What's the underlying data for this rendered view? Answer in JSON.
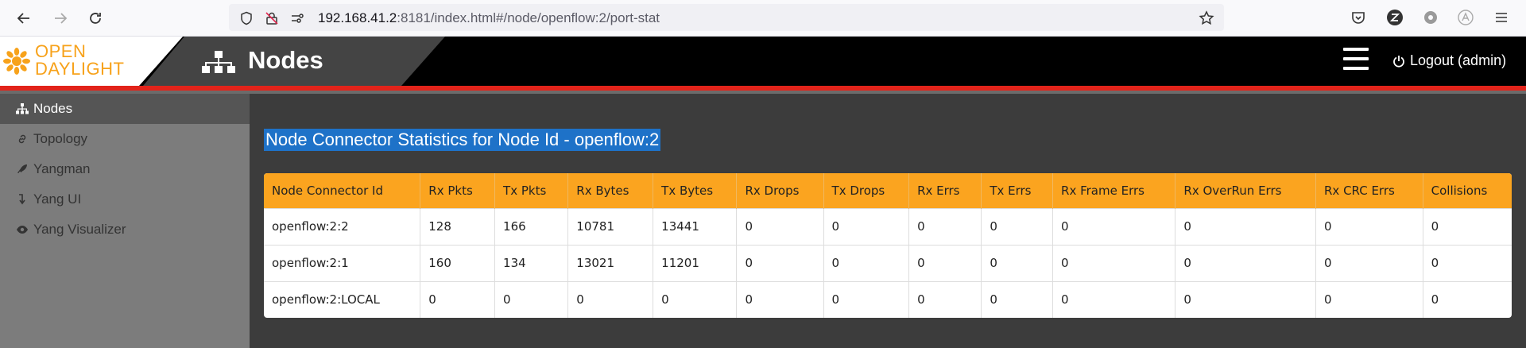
{
  "browser": {
    "url_host": "192.168.41.2",
    "url_path": ":8181/index.html#/node/openflow:2/port-stat"
  },
  "header": {
    "logo_line1": "OPEN",
    "logo_line2": "DAYLIGHT",
    "title": "Nodes",
    "logout_label": "Logout (admin)"
  },
  "sidebar": {
    "items": [
      {
        "label": "Nodes",
        "icon": "sitemap-icon"
      },
      {
        "label": "Topology",
        "icon": "link-icon"
      },
      {
        "label": "Yangman",
        "icon": "rocket-icon"
      },
      {
        "label": "Yang UI",
        "icon": "arrow-down-icon"
      },
      {
        "label": "Yang Visualizer",
        "icon": "eye-icon"
      }
    ]
  },
  "main": {
    "heading": "Node Connector Statistics for Node Id - openflow:2",
    "columns": [
      "Node Connector Id",
      "Rx Pkts",
      "Tx Pkts",
      "Rx Bytes",
      "Tx Bytes",
      "Rx Drops",
      "Tx Drops",
      "Rx Errs",
      "Tx Errs",
      "Rx Frame Errs",
      "Rx OverRun Errs",
      "Rx CRC Errs",
      "Collisions"
    ],
    "rows": [
      [
        "openflow:2:2",
        "128",
        "166",
        "10781",
        "13441",
        "0",
        "0",
        "0",
        "0",
        "0",
        "0",
        "0",
        "0"
      ],
      [
        "openflow:2:1",
        "160",
        "134",
        "13021",
        "11201",
        "0",
        "0",
        "0",
        "0",
        "0",
        "0",
        "0",
        "0"
      ],
      [
        "openflow:2:LOCAL",
        "0",
        "0",
        "0",
        "0",
        "0",
        "0",
        "0",
        "0",
        "0",
        "0",
        "0",
        "0"
      ]
    ]
  },
  "colors": {
    "accent_orange": "#fba41f",
    "header_red": "#e2231a",
    "heading_highlight": "#1e72c8"
  }
}
